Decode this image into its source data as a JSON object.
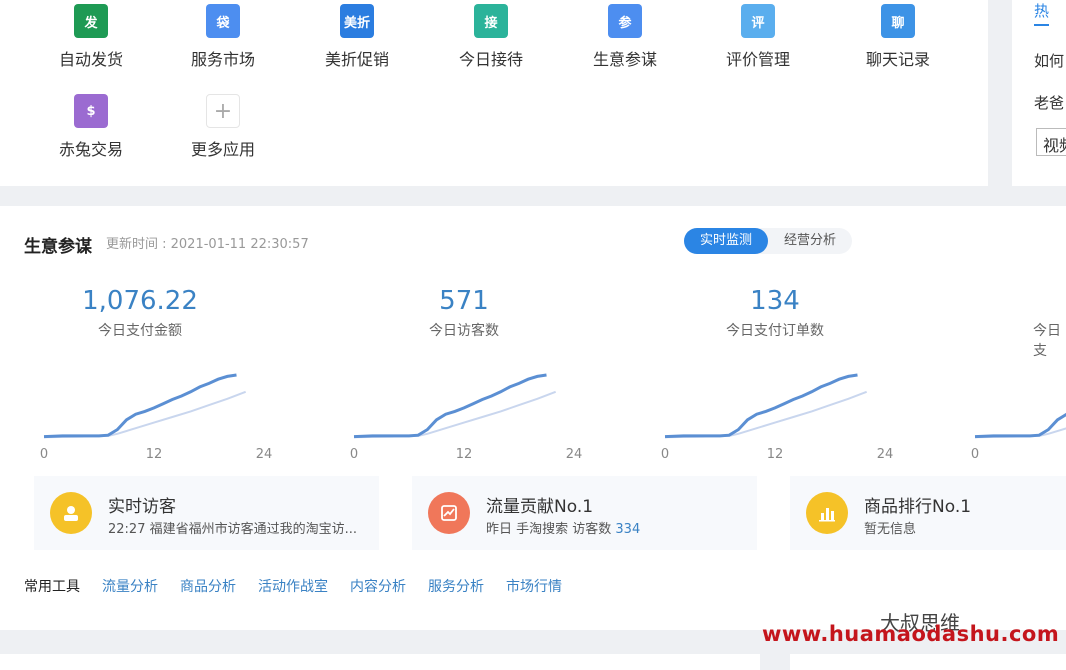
{
  "apps": [
    {
      "label": "自动发货",
      "icon": "delivery-icon",
      "color": "#1e9a54",
      "glyph": "发"
    },
    {
      "label": "服务市场",
      "icon": "bag-icon",
      "color": "#4d8ef0",
      "glyph": "袋"
    },
    {
      "label": "美折促销",
      "icon": "discount-icon",
      "color": "#2b7de0",
      "glyph": "美折"
    },
    {
      "label": "今日接待",
      "icon": "user-icon",
      "color": "#2bb39a",
      "glyph": "接"
    },
    {
      "label": "生意参谋",
      "icon": "compass-icon",
      "color": "#4d8ef0",
      "glyph": "参"
    },
    {
      "label": "评价管理",
      "icon": "review-icon",
      "color": "#5aaeee",
      "glyph": "评"
    },
    {
      "label": "聊天记录",
      "icon": "chat-record-icon",
      "color": "#3d93e6",
      "glyph": "聊"
    },
    {
      "label": "赤兔交易",
      "icon": "money-bag-icon",
      "color": "#9b6bd1",
      "glyph": "$"
    },
    {
      "label": "更多应用",
      "icon": "plus-icon",
      "color": "#ffffff",
      "glyph": "+"
    }
  ],
  "right_panel": {
    "tab": "热 ",
    "line1": "如何",
    "line2": "老爸",
    "button": "视频"
  },
  "business": {
    "title": "生意参谋",
    "update_time": "更新时间 : 2021-01-11 22:30:57",
    "tabs": [
      "实时监测",
      "经营分析"
    ],
    "active_tab": 0
  },
  "metrics": [
    {
      "value": "1,076.22",
      "label": "今日支付金额"
    },
    {
      "value": "571",
      "label": "今日访客数"
    },
    {
      "value": "134",
      "label": "今日支付订单数"
    },
    {
      "value": "",
      "label": "今日支"
    }
  ],
  "chart_data": {
    "type": "line",
    "x_ticks": [
      "0",
      "12",
      "24"
    ],
    "xlim": [
      0,
      24
    ],
    "series": [
      {
        "values_x": [
          0,
          2,
          4,
          6,
          7,
          8,
          9,
          10,
          11,
          12,
          13,
          14,
          15,
          16,
          17,
          18,
          19,
          20,
          21
        ],
        "values_y": [
          0.02,
          0.03,
          0.03,
          0.03,
          0.04,
          0.12,
          0.26,
          0.34,
          0.38,
          0.43,
          0.49,
          0.55,
          0.6,
          0.66,
          0.73,
          0.78,
          0.84,
          0.88,
          0.9
        ],
        "color": "#5b8fd3"
      },
      {
        "values_x": [
          0,
          4,
          7,
          8,
          10,
          12,
          14,
          16,
          18,
          20,
          22
        ],
        "values_y": [
          0.01,
          0.02,
          0.03,
          0.06,
          0.14,
          0.22,
          0.3,
          0.38,
          0.47,
          0.56,
          0.66
        ],
        "color": "#c9d6ee"
      }
    ]
  },
  "info_boxes": [
    {
      "title": "实时访客",
      "sub": "22:27 福建省福州市访客通过我的淘宝访...",
      "num": "",
      "icon": "visitor-icon",
      "color": "#f5c228"
    },
    {
      "title": "流量贡献No.1",
      "sub": "昨日 手淘搜索 访客数 ",
      "num": "334",
      "icon": "traffic-icon",
      "color": "#f0775a"
    },
    {
      "title": "商品排行No.1",
      "sub": "暂无信息",
      "num": "",
      "icon": "rank-icon",
      "color": "#f5c228"
    }
  ],
  "tools": {
    "label": "常用工具",
    "links": [
      "流量分析",
      "商品分析",
      "活动作战室",
      "内容分析",
      "服务分析",
      "市场行情"
    ]
  },
  "watermark": {
    "url": "www.huamaodashu.com",
    "logo_text": "大叔思维"
  }
}
